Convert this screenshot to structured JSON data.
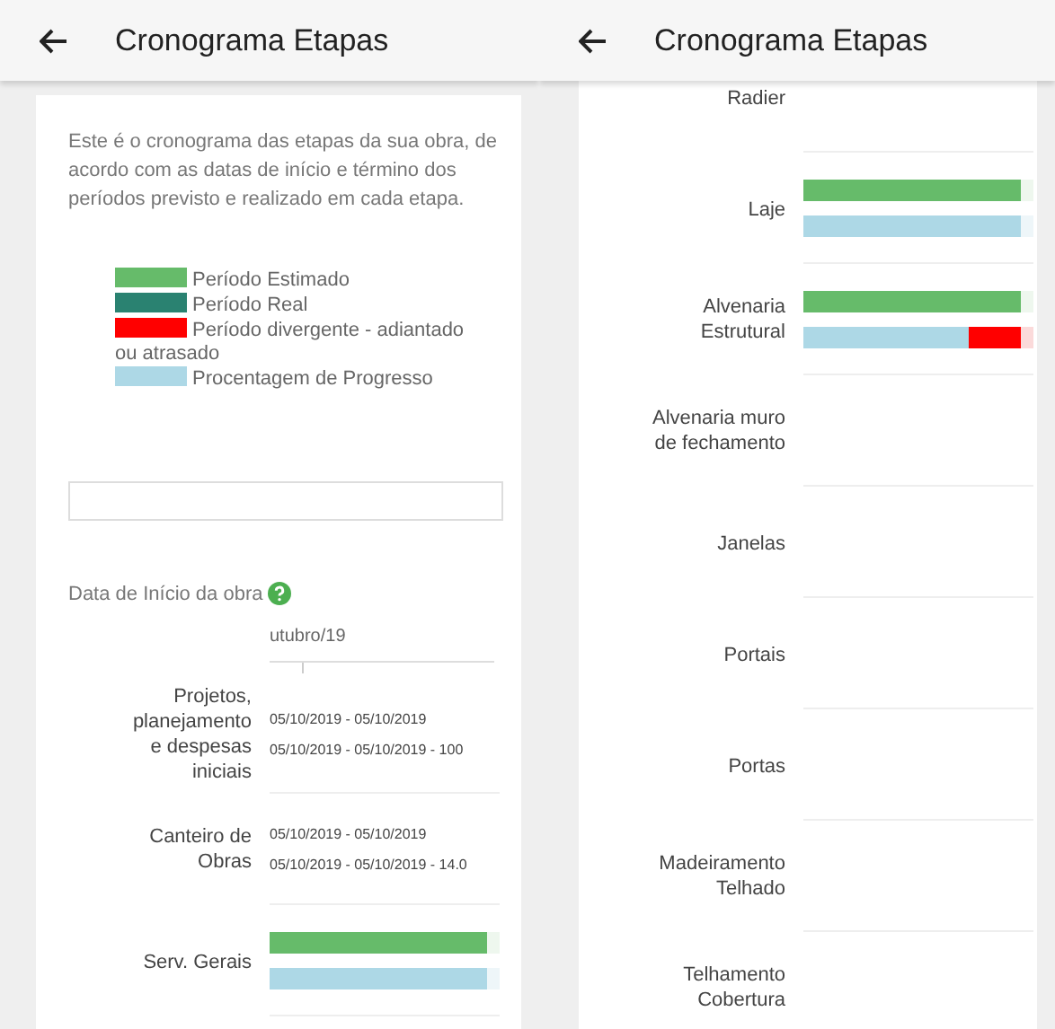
{
  "left_screen": {
    "title": "Cronograma Etapas",
    "intro": "Este é o cronograma das etapas da sua obra, de acordo com as datas de início e término dos períodos previsto e realizado em cada etapa.",
    "legend": [
      {
        "label": "Período Estimado",
        "color": "#66bb6a"
      },
      {
        "label": "Período Real",
        "color": "#2a8271"
      },
      {
        "label": "Período divergente - adiantado ou atrasado",
        "color": "#ff0000"
      },
      {
        "label": "Procentagem de Progresso",
        "color": "#add8e6"
      }
    ],
    "start_label": "Data de Início da obra",
    "month": "utubro/19",
    "stages": [
      {
        "name": "Projetos, planejamento e despesas iniciais",
        "kind": "dates",
        "lines": [
          "05/10/2019 - 05/10/2019",
          "05/10/2019 - 05/10/2019 - 100"
        ]
      },
      {
        "name": "Canteiro de Obras",
        "kind": "dates",
        "lines": [
          "05/10/2019 - 05/10/2019",
          "05/10/2019 - 05/10/2019 - 14.0"
        ]
      },
      {
        "name": "Serv. Gerais",
        "kind": "bars",
        "bars": [
          {
            "kind": "estimated",
            "level": 1
          },
          {
            "kind": "progress",
            "level": 1,
            "divergent": false
          }
        ]
      }
    ]
  },
  "right_screen": {
    "title": "Cronograma Etapas",
    "stages": [
      {
        "name": "Radier",
        "kind": "empty"
      },
      {
        "name": "Laje",
        "kind": "bars",
        "bars": [
          {
            "kind": "estimated",
            "level": 1
          },
          {
            "kind": "progress",
            "level": 1,
            "divergent": false
          }
        ]
      },
      {
        "name": "Alvenaria Estrutural",
        "kind": "bars",
        "bars": [
          {
            "kind": "estimated",
            "level": 1
          },
          {
            "kind": "progress",
            "level": 0.76,
            "divergent": true
          }
        ]
      },
      {
        "name": "Alvenaria muro de fechamento",
        "kind": "empty"
      },
      {
        "name": "Janelas",
        "kind": "empty"
      },
      {
        "name": "Portais",
        "kind": "empty"
      },
      {
        "name": "Portas",
        "kind": "empty"
      },
      {
        "name": "Madeiramento Telhado",
        "kind": "empty"
      },
      {
        "name": "Telhamento Cobertura",
        "kind": "empty"
      }
    ]
  }
}
